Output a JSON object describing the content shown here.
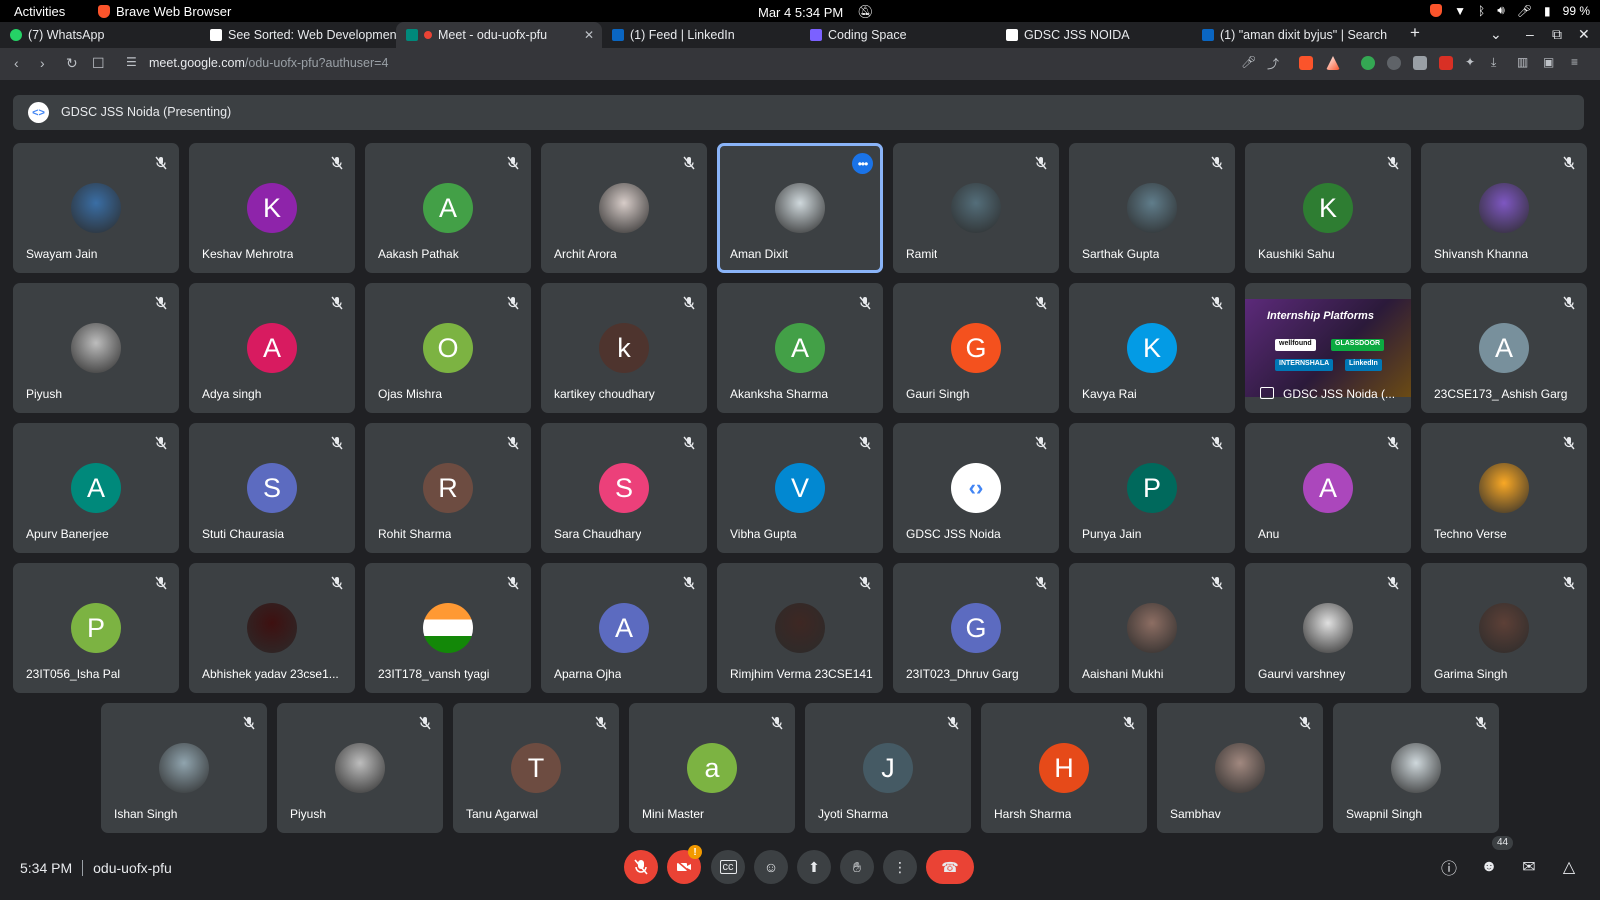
{
  "os": {
    "activities": "Activities",
    "app_name": "Brave Web Browser",
    "datetime": "Mar 4  5:34 PM",
    "battery": "99 %"
  },
  "tabs": [
    {
      "label": "(7) WhatsApp",
      "color": "#25d366"
    },
    {
      "label": "See Sorted: Web Developmen",
      "color": "#ffffff"
    },
    {
      "label": "Meet - odu-uofx-pfu",
      "color": "#00897b",
      "active": true
    },
    {
      "label": "(1) Feed | LinkedIn",
      "color": "#0a66c2"
    },
    {
      "label": "Coding Space",
      "color": "#7b61ff"
    },
    {
      "label": "GDSC JSS NOIDA",
      "color": "#ffffff"
    },
    {
      "label": "(1) \"aman dixit byjus\" | Search",
      "color": "#0a66c2"
    }
  ],
  "address": {
    "host": "meet.google.com",
    "path": "/odu-uofx-pfu?authuser=4"
  },
  "banner": {
    "text": "GDSC JSS Noida (Presenting)"
  },
  "participants": [
    {
      "name": "Swayam Jain",
      "initial": "",
      "color": "#3a6ea5",
      "photo": true
    },
    {
      "name": "Keshav Mehrotra",
      "initial": "K",
      "color": "#8e24aa"
    },
    {
      "name": "Aakash Pathak",
      "initial": "A",
      "color": "#43a047"
    },
    {
      "name": "Archit Arora",
      "initial": "",
      "color": "#d7ccc8",
      "photo": true
    },
    {
      "name": "Aman Dixit",
      "initial": "",
      "color": "#cfd8dc",
      "photo": true,
      "speaking": true
    },
    {
      "name": "Ramit",
      "initial": "",
      "color": "#546e7a",
      "photo": true
    },
    {
      "name": "Sarthak Gupta",
      "initial": "",
      "color": "#607d8b",
      "photo": true
    },
    {
      "name": "Kaushiki Sahu",
      "initial": "K",
      "color": "#2e7d32"
    },
    {
      "name": "Shivansh Khanna",
      "initial": "",
      "color": "#7e57c2",
      "photo": true
    },
    {
      "name": "Piyush",
      "initial": "",
      "color": "#bdbdbd",
      "photo": true
    },
    {
      "name": "Adya singh",
      "initial": "A",
      "color": "#d81b60"
    },
    {
      "name": "Ojas Mishra",
      "initial": "O",
      "color": "#7cb342"
    },
    {
      "name": "kartikey choudhary",
      "initial": "k",
      "color": "#4e342e"
    },
    {
      "name": "Akanksha Sharma",
      "initial": "A",
      "color": "#43a047"
    },
    {
      "name": "Gauri Singh",
      "initial": "G",
      "color": "#f4511e"
    },
    {
      "name": "Kavya Rai",
      "initial": "K",
      "color": "#039be5"
    },
    {
      "name": "GDSC JSS Noida (...",
      "initial": "",
      "color": "#5c2a7a",
      "presentation": true
    },
    {
      "name": "23CSE173_ Ashish Garg",
      "initial": "A",
      "color": "#78909c"
    },
    {
      "name": "Apurv Banerjee",
      "initial": "A",
      "color": "#00897b"
    },
    {
      "name": "Stuti Chaurasia",
      "initial": "S",
      "color": "#5c6bc0"
    },
    {
      "name": "Rohit Sharma",
      "initial": "R",
      "color": "#6d4c41"
    },
    {
      "name": "Sara Chaudhary",
      "initial": "S",
      "color": "#ec407a"
    },
    {
      "name": "Vibha Gupta",
      "initial": "V",
      "color": "#0288d1"
    },
    {
      "name": "GDSC JSS Noida",
      "initial": "",
      "color": "#ffffff",
      "photo": true,
      "gdsc": true
    },
    {
      "name": "Punya Jain",
      "initial": "P",
      "color": "#00695c"
    },
    {
      "name": "Anu",
      "initial": "A",
      "color": "#ab47bc"
    },
    {
      "name": "Techno Verse",
      "initial": "",
      "color": "#f9a825",
      "photo": true
    },
    {
      "name": "23IT056_Isha Pal",
      "initial": "P",
      "color": "#7cb342"
    },
    {
      "name": "Abhishek yadav 23cse1...",
      "initial": "",
      "color": "#3e1010",
      "photo": true
    },
    {
      "name": "23IT178_vansh tyagi",
      "initial": "",
      "color": "#ff9933",
      "photo": true,
      "flag": true
    },
    {
      "name": "Aparna Ojha",
      "initial": "A",
      "color": "#5c6bc0"
    },
    {
      "name": "Rimjhim Verma 23CSE141",
      "initial": "",
      "color": "#3e2723",
      "photo": true
    },
    {
      "name": "23IT023_Dhruv Garg",
      "initial": "G",
      "color": "#5c6bc0"
    },
    {
      "name": "Aaishani Mukhi",
      "initial": "",
      "color": "#8d6e63",
      "photo": true
    },
    {
      "name": "Gaurvi varshney",
      "initial": "",
      "color": "#e0e0e0",
      "photo": true
    },
    {
      "name": "Garima Singh",
      "initial": "",
      "color": "#5d4037",
      "photo": true
    },
    {
      "name": "Ishan Singh",
      "initial": "",
      "color": "#90a4ae",
      "photo": true
    },
    {
      "name": "Piyush",
      "initial": "",
      "color": "#bdbdbd",
      "photo": true
    },
    {
      "name": "Tanu Agarwal",
      "initial": "T",
      "color": "#6d4c41"
    },
    {
      "name": "Mini Master",
      "initial": "a",
      "color": "#7cb342"
    },
    {
      "name": "Jyoti Sharma",
      "initial": "J",
      "color": "#455a64"
    },
    {
      "name": "Harsh Sharma",
      "initial": "H",
      "color": "#e64a19"
    },
    {
      "name": "Sambhav",
      "initial": "",
      "color": "#a1887f",
      "photo": true
    },
    {
      "name": "Swapnil Singh",
      "initial": "",
      "color": "#cfd8dc",
      "photo": true
    }
  ],
  "presentation_slide": {
    "title": "Internship Platforms",
    "chips": [
      "wellfound",
      "GLASSDOOR",
      "INTERNSHALA",
      "LinkedIn"
    ]
  },
  "bottom": {
    "time": "5:34 PM",
    "meeting_code": "odu-uofx-pfu",
    "camera_badge": "!",
    "people_count": "44"
  }
}
